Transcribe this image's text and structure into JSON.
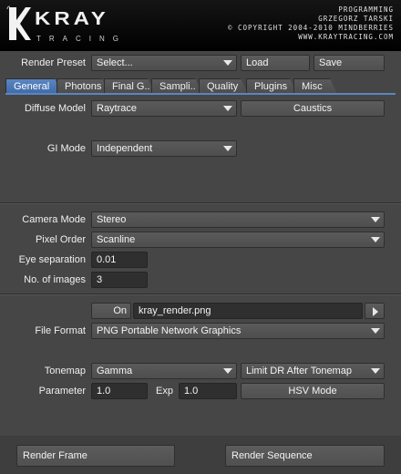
{
  "header": {
    "logo_text": "KRAY",
    "logo_sub": "TRACING",
    "credits": [
      "PROGRAMMING",
      "GRZEGORZ TARSKI",
      "© COPYRIGHT 2004-2010 MINDBERRIES",
      "WWW.KRAYTRACING.COM"
    ]
  },
  "render_preset": {
    "label": "Render Preset",
    "value": "Select...",
    "load": "Load",
    "save": "Save"
  },
  "tabs": [
    "General",
    "Photons",
    "Final G..",
    "Sampli..",
    "Quality",
    "Plugins",
    "Misc"
  ],
  "diffuse": {
    "label": "Diffuse Model",
    "value": "Raytrace",
    "caustics": "Caustics"
  },
  "gi": {
    "label": "GI Mode",
    "value": "Independent"
  },
  "camera": {
    "label": "Camera Mode",
    "value": "Stereo"
  },
  "pixel_order": {
    "label": "Pixel Order",
    "value": "Scanline"
  },
  "eye_sep": {
    "label": "Eye separation",
    "value": "0.01"
  },
  "num_images": {
    "label": "No. of images",
    "value": "3"
  },
  "output": {
    "on": "On",
    "filename": "kray_render.png"
  },
  "file_format": {
    "label": "File Format",
    "value": "PNG Portable Network Graphics"
  },
  "tonemap": {
    "label": "Tonemap",
    "value": "Gamma",
    "limit": "Limit DR After Tonemap"
  },
  "parameter": {
    "label": "Parameter",
    "value": "1.0",
    "exp_label": "Exp",
    "exp_value": "1.0",
    "hsv": "HSV Mode"
  },
  "footer": {
    "render_frame": "Render Frame",
    "render_sequence": "Render Sequence"
  }
}
